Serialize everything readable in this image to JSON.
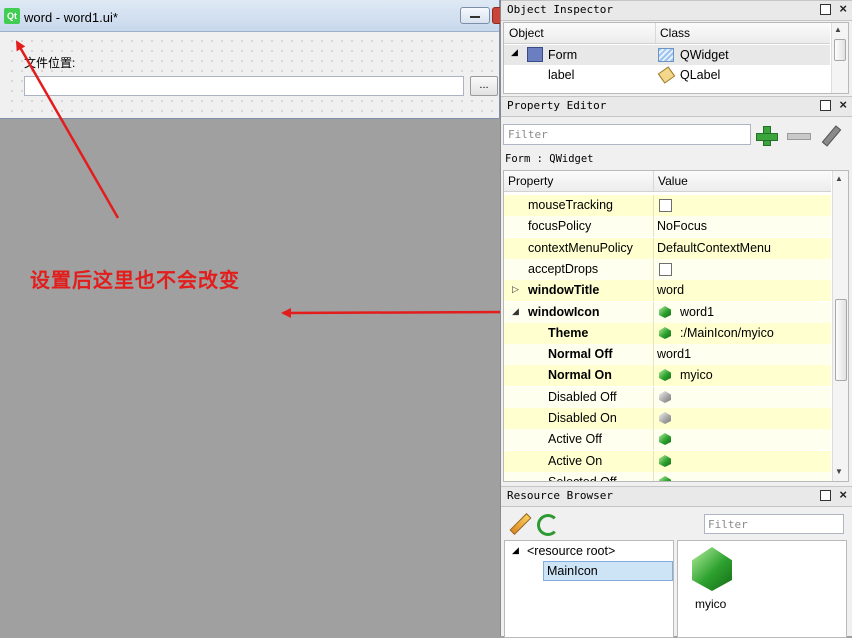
{
  "form_window": {
    "title": "word - word1.ui*",
    "logo_text": "Qt",
    "file_label": "文件位置:",
    "browse_label": "..."
  },
  "annotation": {
    "text": "设置后这里也不会改变",
    "color": "#e31c1c"
  },
  "object_inspector": {
    "title": "Object Inspector",
    "columns": [
      "Object",
      "Class"
    ],
    "rows": [
      {
        "object": "Form",
        "class": "QWidget",
        "icon": "form-icon",
        "class_icon": "widget-icon"
      },
      {
        "object": "label",
        "class": "QLabel",
        "icon": "",
        "class_icon": "label-tag-icon"
      }
    ]
  },
  "property_editor": {
    "title": "Property Editor",
    "filter_placeholder": "Filter",
    "context": "Form : QWidget",
    "columns": [
      "Property",
      "Value"
    ],
    "rows": [
      {
        "name": "mouseTracking",
        "value": "",
        "type": "checkbox",
        "bold": false,
        "indent": 1
      },
      {
        "name": "focusPolicy",
        "value": "NoFocus",
        "type": "text",
        "bold": false,
        "indent": 1
      },
      {
        "name": "contextMenuPolicy",
        "value": "DefaultContextMenu",
        "type": "text",
        "bold": false,
        "indent": 1
      },
      {
        "name": "acceptDrops",
        "value": "",
        "type": "checkbox",
        "bold": false,
        "indent": 1
      },
      {
        "name": "windowTitle",
        "value": "word",
        "type": "text",
        "bold": true,
        "indent": 1,
        "expander": "collapsed"
      },
      {
        "name": "windowIcon",
        "value": "word1",
        "type": "icon-green",
        "bold": true,
        "indent": 1,
        "expander": "expanded"
      },
      {
        "name": "Theme",
        "value": ":/MainIcon/myico",
        "type": "icon-green",
        "bold": true,
        "indent": 2
      },
      {
        "name": "Normal Off",
        "value": "word1",
        "type": "text",
        "bold": true,
        "indent": 2
      },
      {
        "name": "Normal On",
        "value": "myico",
        "type": "icon-green",
        "bold": true,
        "indent": 2
      },
      {
        "name": "Disabled Off",
        "value": "",
        "type": "icon-grey",
        "bold": false,
        "indent": 2
      },
      {
        "name": "Disabled On",
        "value": "",
        "type": "icon-grey",
        "bold": false,
        "indent": 2
      },
      {
        "name": "Active Off",
        "value": "",
        "type": "icon-green",
        "bold": false,
        "indent": 2
      },
      {
        "name": "Active On",
        "value": "",
        "type": "icon-green",
        "bold": false,
        "indent": 2
      },
      {
        "name": "Selected Off",
        "value": "",
        "type": "icon-green",
        "bold": false,
        "indent": 2
      }
    ]
  },
  "resource_browser": {
    "title": "Resource Browser",
    "filter_placeholder": "Filter",
    "tree": [
      {
        "label": "<resource root>",
        "expanded": true
      },
      {
        "label": "MainIcon",
        "selected": true
      }
    ],
    "files": [
      {
        "name": "myico"
      }
    ]
  },
  "colors": {
    "row_yellow": "#ffffd0",
    "row_yellow_alt": "#fffff0",
    "arrow": "#e31c1c",
    "selection": "#cde4f7"
  }
}
